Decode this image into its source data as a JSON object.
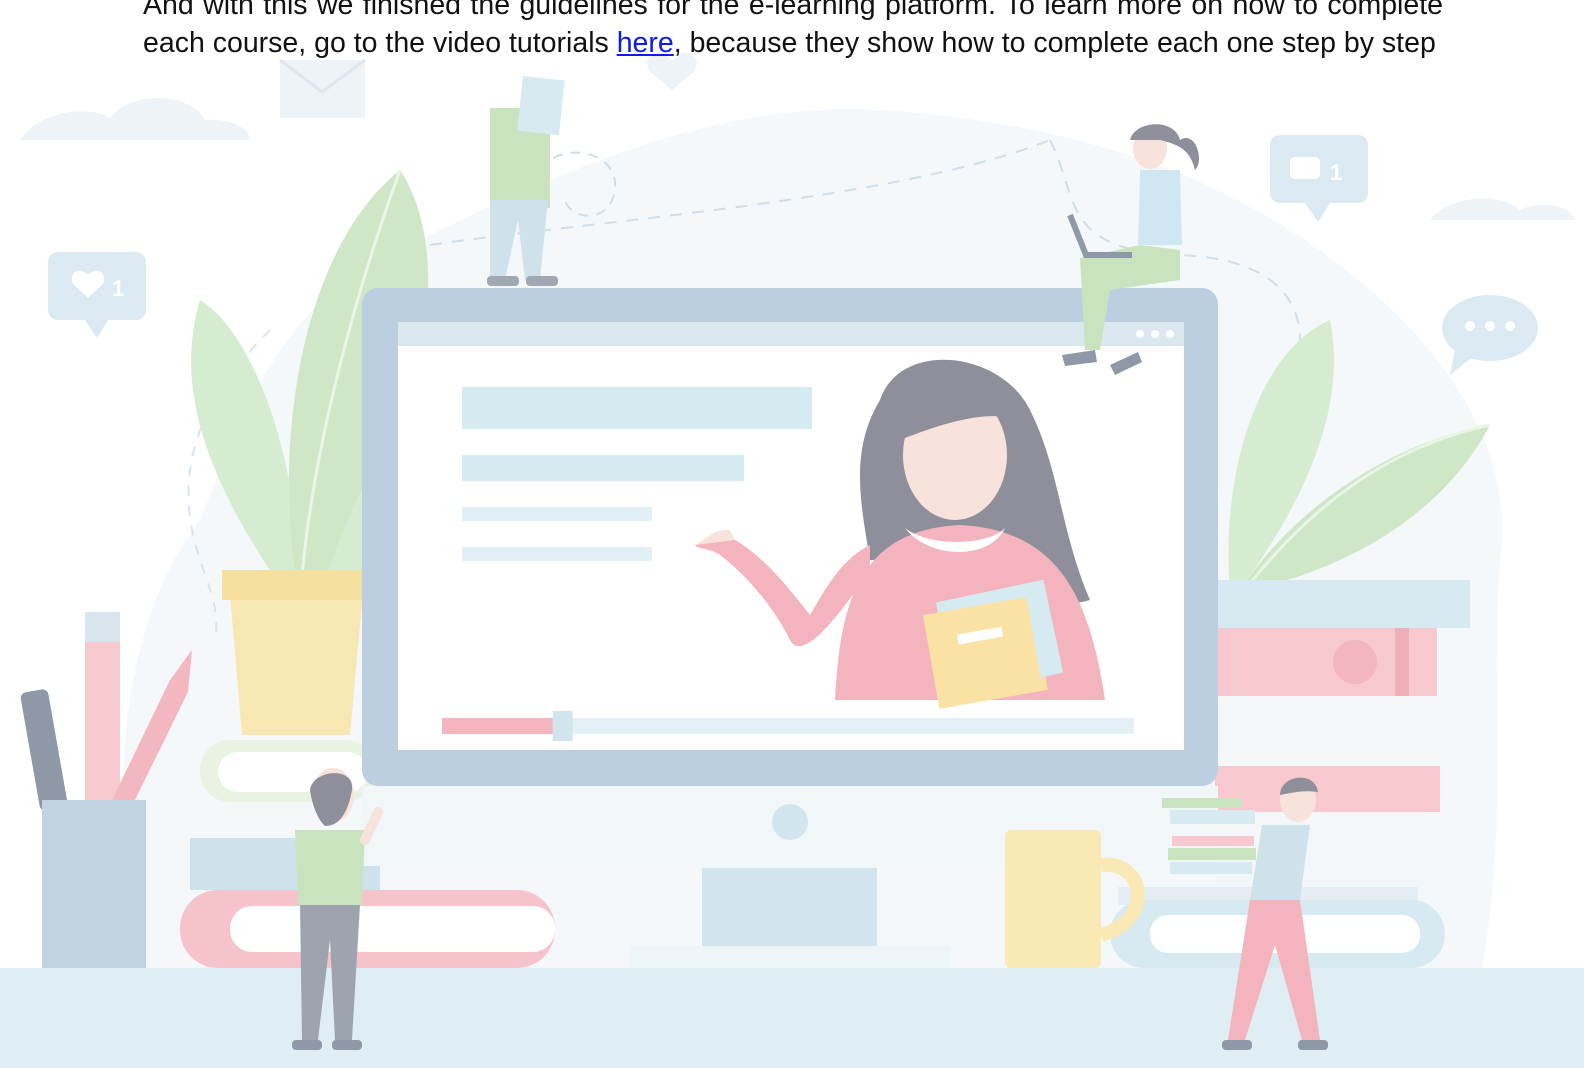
{
  "document": {
    "paragraph_part1": "And with this we finished the guidelines for the e-learning platform. To learn more on how to complete each course, go to the video tutorials ",
    "link_text": "here",
    "paragraph_part2": ", because they show how to complete each one step by step"
  },
  "illustration": {
    "social_likes_count": "1",
    "social_comments_count": "1",
    "video_progress": 0.16
  },
  "colors": {
    "text": "#111111",
    "link": "#0b1de6",
    "monitor_frame": "#bccfe1",
    "screen_bg": "#ffffff",
    "accent_light_blue": "#d4eaf2",
    "accent_red": "#f0a1ab",
    "accent_yellow": "#f9e2a3",
    "accent_green": "#c9e3bf",
    "hair_gray": "#8f8f9c",
    "floor": "#dfeef3"
  }
}
